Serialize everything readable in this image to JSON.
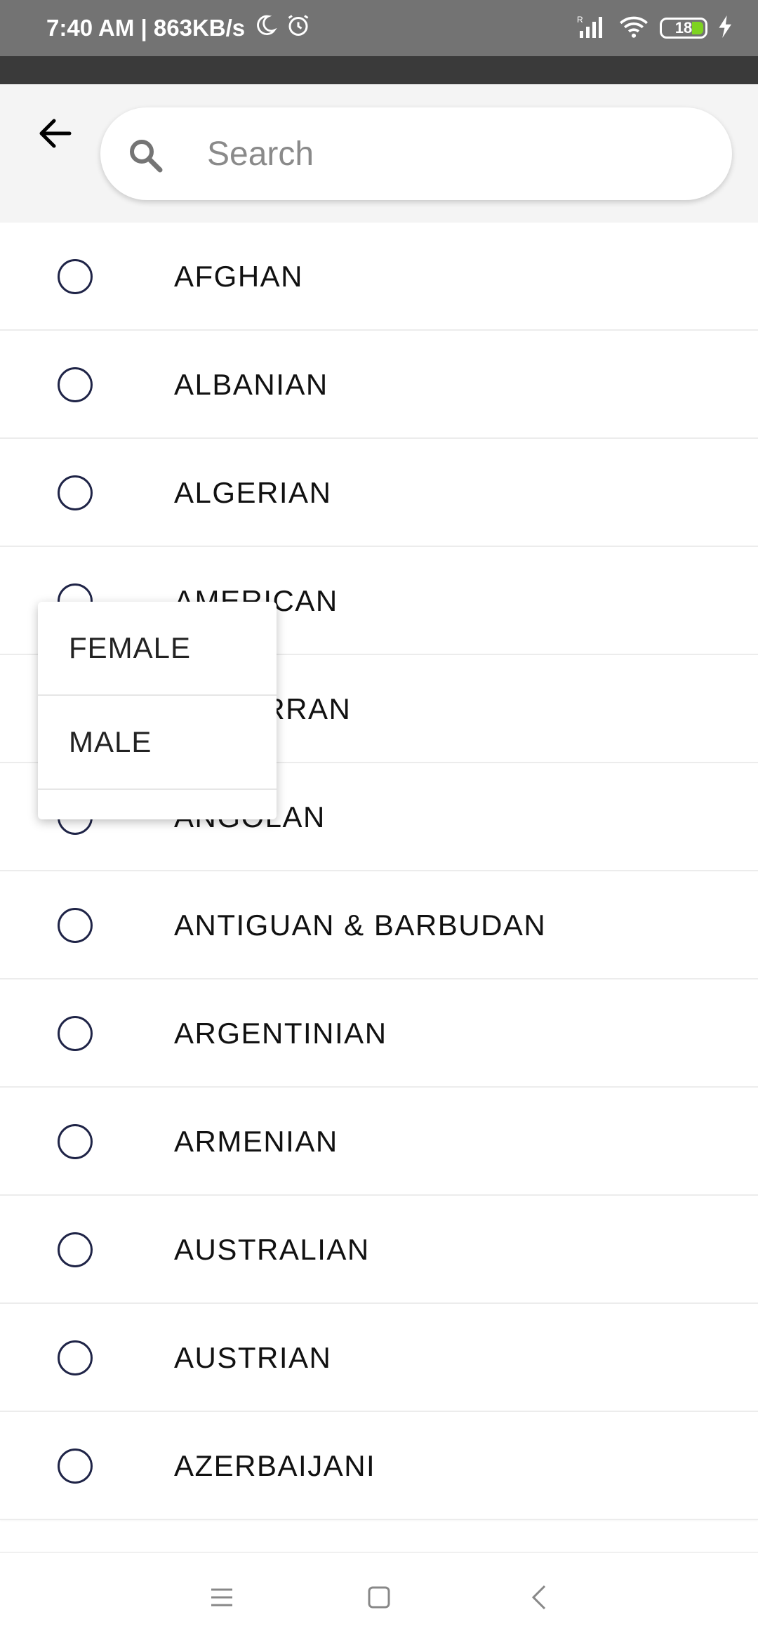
{
  "status_bar": {
    "time_speed": "7:40 AM | 863KB/s",
    "battery_level": "18",
    "icons": [
      "moon-icon",
      "alarm-icon",
      "signal-icon",
      "wifi-icon",
      "battery-icon",
      "charging-icon"
    ]
  },
  "header": {
    "back_icon": "arrow-left-icon",
    "search": {
      "placeholder": "Search",
      "value": "",
      "icon": "search-icon"
    }
  },
  "list": {
    "items": [
      {
        "label": "AFGHAN",
        "selected": false
      },
      {
        "label": "ALBANIAN",
        "selected": false
      },
      {
        "label": "ALGERIAN",
        "selected": false
      },
      {
        "label": "AMERICAN",
        "selected": false
      },
      {
        "label": "ANDORRAN",
        "selected": false
      },
      {
        "label": "ANGOLAN",
        "selected": false
      },
      {
        "label": "ANTIGUAN & BARBUDAN",
        "selected": false
      },
      {
        "label": "ARGENTINIAN",
        "selected": false
      },
      {
        "label": "ARMENIAN",
        "selected": false
      },
      {
        "label": "AUSTRALIAN",
        "selected": false
      },
      {
        "label": "AUSTRIAN",
        "selected": false
      },
      {
        "label": "AZERBAIJANI",
        "selected": false
      }
    ]
  },
  "dropdown": {
    "options": [
      "FEMALE",
      "MALE"
    ]
  },
  "nav_bar": {
    "icons": [
      "menu-icon",
      "home-icon",
      "back-icon"
    ]
  },
  "colors": {
    "status_bar": "#737373",
    "header_bg": "#f4f4f4",
    "radio_border": "#1f2447",
    "battery_fill": "#7ed321"
  }
}
